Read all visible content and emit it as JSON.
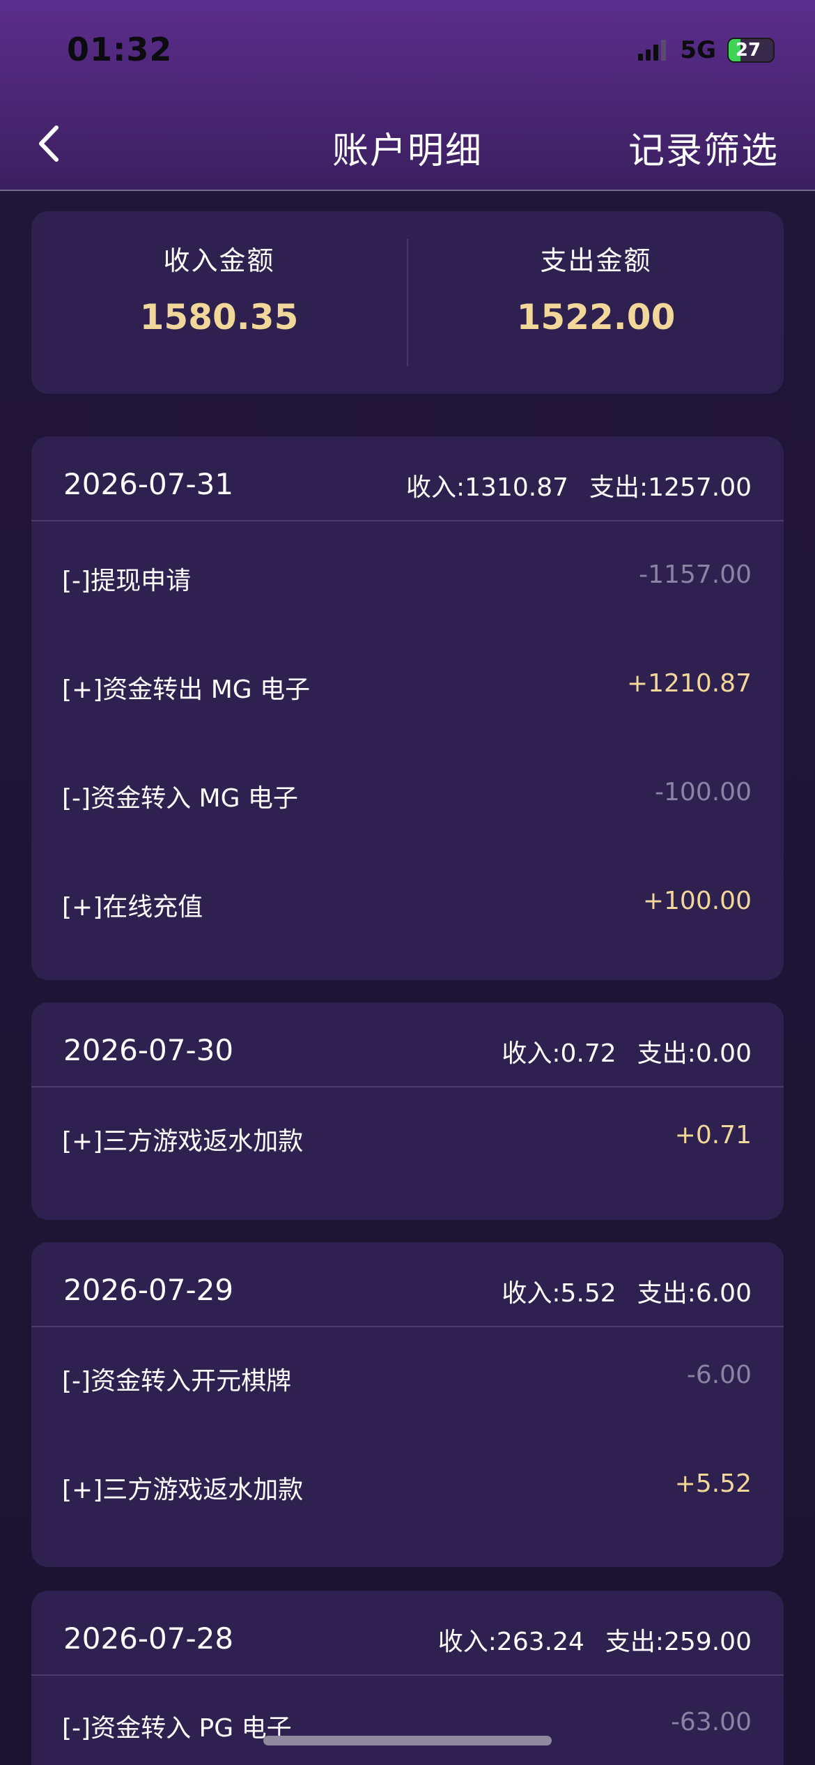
{
  "status_bar": {
    "time": "01:32",
    "network": "5G",
    "battery": "27",
    "battery_level": 0.27
  },
  "header": {
    "title": "账户明细",
    "filter_label": "记录筛选",
    "back_icon": "chevron-left-icon"
  },
  "summary": {
    "income_label": "收入金额",
    "income_value": "1580.35",
    "expense_label": "支出金额",
    "expense_value": "1522.00"
  },
  "days": [
    {
      "date": "2026-07-31",
      "income": "收入:1310.87",
      "expense": "支出:1257.00",
      "items": [
        {
          "label": "[-]提现申请",
          "amount": "-1157.00",
          "sign": "neg"
        },
        {
          "label": "[+]资金转出 MG 电子",
          "amount": "+1210.87",
          "sign": "pos"
        },
        {
          "label": "[-]资金转入 MG 电子",
          "amount": "-100.00",
          "sign": "neg"
        },
        {
          "label": "[+]在线充值",
          "amount": "+100.00",
          "sign": "pos"
        }
      ]
    },
    {
      "date": "2026-07-30",
      "income": "收入:0.72",
      "expense": "支出:0.00",
      "items": [
        {
          "label": "[+]三方游戏返水加款",
          "amount": "+0.71",
          "sign": "pos"
        }
      ]
    },
    {
      "date": "2026-07-29",
      "income": "收入:5.52",
      "expense": "支出:6.00",
      "items": [
        {
          "label": "[-]资金转入开元棋牌",
          "amount": "-6.00",
          "sign": "neg"
        },
        {
          "label": "[+]三方游戏返水加款",
          "amount": "+5.52",
          "sign": "pos"
        }
      ]
    },
    {
      "date": "2026-07-28",
      "income": "收入:263.24",
      "expense": "支出:259.00",
      "items": [
        {
          "label": "[-]资金转入 PG 电子",
          "amount": "-63.00",
          "sign": "neg"
        }
      ]
    }
  ]
}
